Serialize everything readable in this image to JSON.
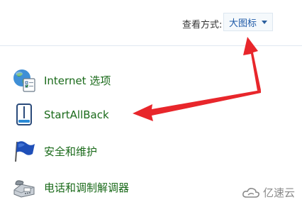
{
  "toolbar": {
    "view_label": "查看方式:",
    "view_value": "大图标"
  },
  "items": [
    {
      "label": "Internet 选项",
      "icon": "globe-options-icon"
    },
    {
      "label": "StartAllBack",
      "icon": "startallback-icon"
    },
    {
      "label": "安全和维护",
      "icon": "security-flag-icon"
    },
    {
      "label": "电话和调制解调器",
      "icon": "phone-modem-icon"
    }
  ],
  "watermark": {
    "text": "亿速云"
  },
  "colors": {
    "link_green": "#1a6a1a",
    "dropdown_text": "#1e5aa8",
    "annotation_red": "#e8262b"
  }
}
